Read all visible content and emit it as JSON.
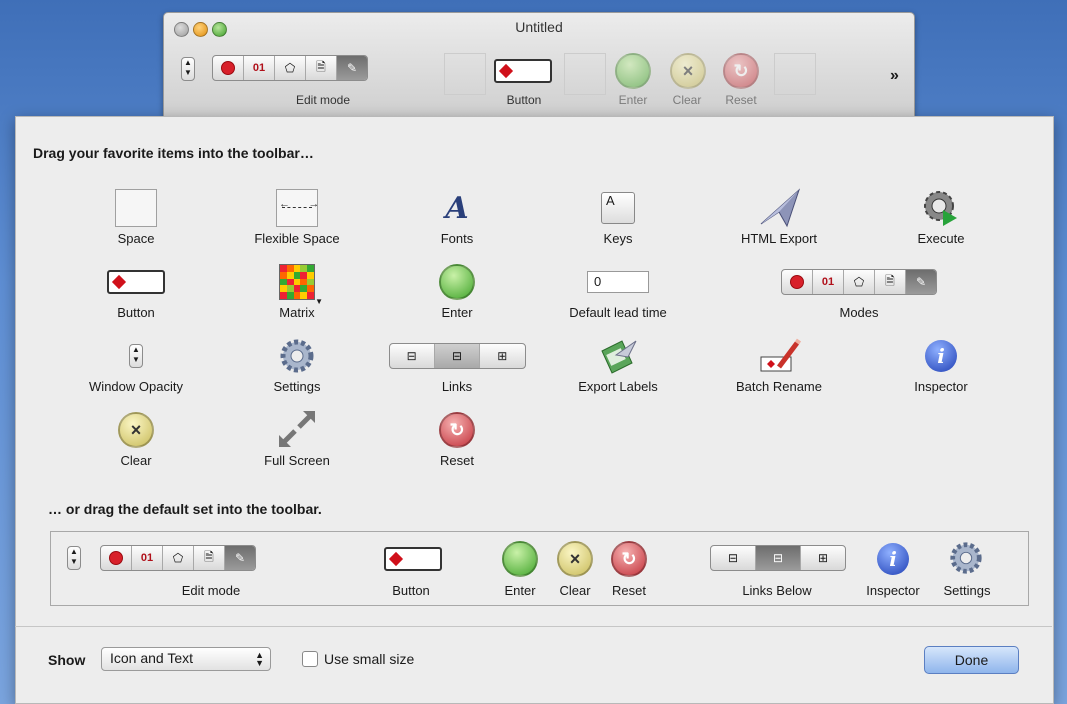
{
  "window": {
    "title": "Untitled",
    "toolbar": {
      "edit_mode_label": "Edit mode",
      "button_label": "Button",
      "enter_label": "Enter",
      "clear_label": "Clear",
      "reset_label": "Reset",
      "overflow": "»"
    }
  },
  "sheet": {
    "heading": "Drag your favorite items into the toolbar…",
    "items": {
      "space": "Space",
      "flexible_space": "Flexible Space",
      "fonts": "Fonts",
      "keys": "Keys",
      "html_export": "HTML Export",
      "execute": "Execute",
      "button": "Button",
      "matrix": "Matrix",
      "enter": "Enter",
      "default_lead_time": "Default lead time",
      "default_lead_time_value": "0",
      "modes": "Modes",
      "window_opacity": "Window Opacity",
      "settings": "Settings",
      "links": "Links",
      "export_labels": "Export Labels",
      "batch_rename": "Batch Rename",
      "inspector": "Inspector",
      "clear": "Clear",
      "full_screen": "Full Screen",
      "reset": "Reset"
    },
    "default_heading": "… or drag the default set into the toolbar.",
    "default_set": {
      "edit_mode": "Edit mode",
      "button": "Button",
      "enter": "Enter",
      "clear": "Clear",
      "reset": "Reset",
      "links_below": "Links Below",
      "inspector": "Inspector",
      "settings": "Settings"
    },
    "footer": {
      "show_label": "Show",
      "show_value": "Icon and Text",
      "small_size_label": "Use small size",
      "done_label": "Done"
    },
    "glyphs": {
      "zero_one": "01",
      "key_letter": "A",
      "fonts_letter": "A",
      "info_letter": "i",
      "clear_glyph": "×",
      "reset_glyph": "↻"
    }
  }
}
